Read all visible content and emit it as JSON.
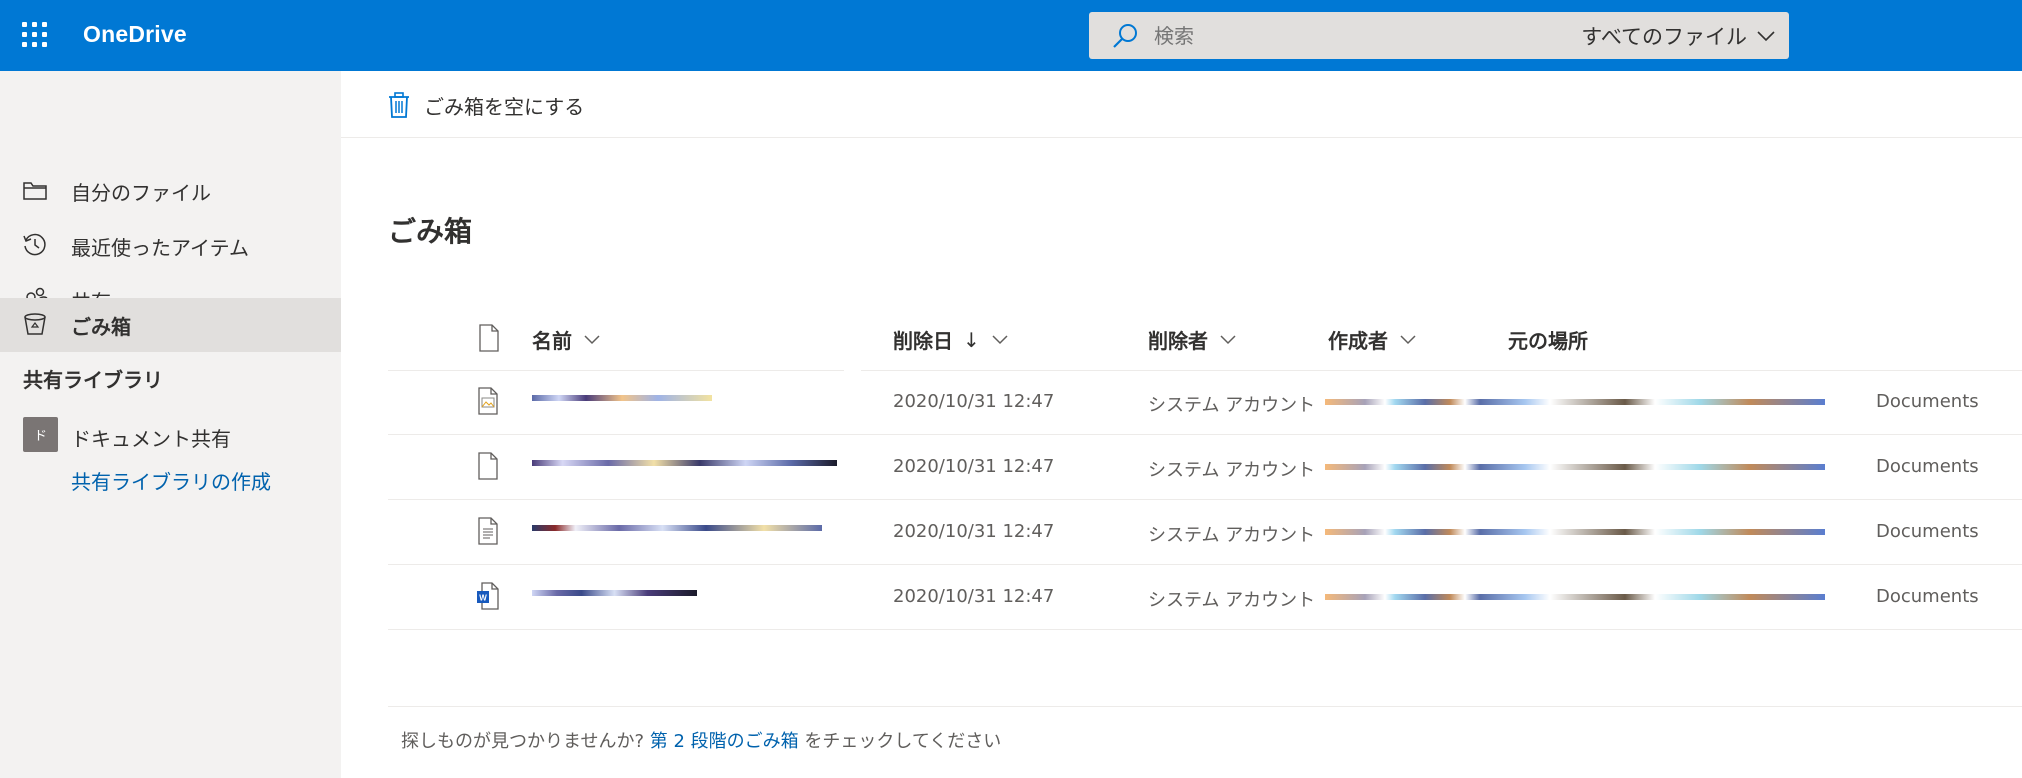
{
  "header": {
    "app_name": "OneDrive",
    "search_placeholder": "検索",
    "search_scope": "すべてのファイル",
    "brand_color": "#0078d4"
  },
  "sidebar": {
    "items": [
      {
        "label": "自分のファイル",
        "icon": "folder-icon"
      },
      {
        "label": "最近使ったアイテム",
        "icon": "clock-icon"
      },
      {
        "label": "共有",
        "icon": "people-icon"
      },
      {
        "label": "ごみ箱",
        "icon": "recycle-bin-icon",
        "active": true
      }
    ],
    "section_title": "共有ライブラリ",
    "library": {
      "initial": "ド",
      "label": "ドキュメント共有"
    },
    "create_library": "共有ライブラリの作成"
  },
  "command_bar": {
    "empty_recycle_bin": "ごみ箱を空にする"
  },
  "page_title": "ごみ箱",
  "table": {
    "columns": {
      "name": "名前",
      "deleted_date": "削除日",
      "sort_arrow": "↓",
      "deleted_by": "削除者",
      "created_by": "作成者",
      "original_location": "元の場所"
    },
    "rows": [
      {
        "icon": "image-file-icon",
        "deleted_date": "2020/10/31 12:47",
        "deleted_by": "システム アカウント",
        "location_suffix": "Documents"
      },
      {
        "icon": "generic-file-icon",
        "deleted_date": "2020/10/31 12:47",
        "deleted_by": "システム アカウント",
        "location_suffix": "Documents"
      },
      {
        "icon": "text-file-icon",
        "deleted_date": "2020/10/31 12:47",
        "deleted_by": "システム アカウント",
        "location_suffix": "Documents"
      },
      {
        "icon": "word-file-icon",
        "deleted_date": "2020/10/31 12:47",
        "deleted_by": "システム アカウント",
        "location_suffix": "Documents"
      }
    ]
  },
  "footer": {
    "prefix": "探しものが見つかりませんか?",
    "link": "第 2 段階のごみ箱",
    "suffix": "をチェックしてください"
  }
}
